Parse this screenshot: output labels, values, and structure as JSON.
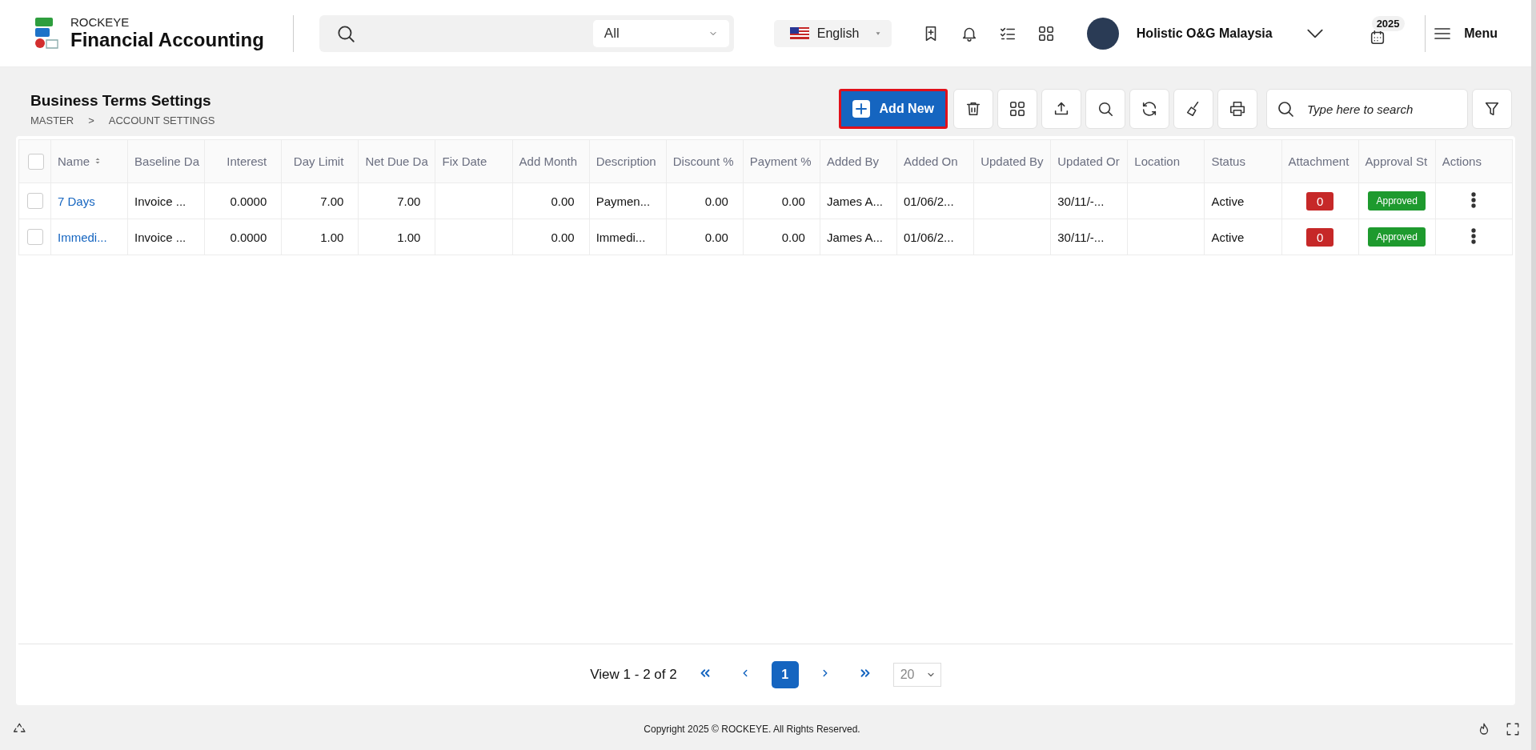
{
  "header": {
    "brand_small": "ROCKEYE",
    "brand_title": "Financial Accounting",
    "search": {
      "scope": "All"
    },
    "language": "English",
    "company": "Holistic O&G Malaysia",
    "year": "2025",
    "menu_label": "Menu"
  },
  "page": {
    "title": "Business Terms Settings",
    "breadcrumb": [
      "MASTER",
      "ACCOUNT SETTINGS"
    ],
    "breadcrumb_separator": ">"
  },
  "toolbar": {
    "add_button": "Add New",
    "search": {
      "placeholder": "Type here to search"
    }
  },
  "table": {
    "all_selected": false,
    "columns": [
      {
        "label": "Name",
        "kind": "link",
        "sortable": true
      },
      {
        "label": "Baseline Da",
        "kind": "text"
      },
      {
        "label": "Interest",
        "kind": "num"
      },
      {
        "label": "Day Limit",
        "kind": "num"
      },
      {
        "label": "Net Due Da",
        "kind": "num"
      },
      {
        "label": "Fix Date",
        "kind": "text"
      },
      {
        "label": "Add Month",
        "kind": "num"
      },
      {
        "label": "Description",
        "kind": "text"
      },
      {
        "label": "Discount %",
        "kind": "num"
      },
      {
        "label": "Payment %",
        "kind": "num"
      },
      {
        "label": "Added By",
        "kind": "text"
      },
      {
        "label": "Added On",
        "kind": "text"
      },
      {
        "label": "Updated By",
        "kind": "text"
      },
      {
        "label": "Updated Or",
        "kind": "text"
      },
      {
        "label": "Location",
        "kind": "text"
      },
      {
        "label": "Status",
        "kind": "text"
      },
      {
        "label": "Attachment",
        "kind": "count"
      },
      {
        "label": "Approval St",
        "kind": "approval"
      },
      {
        "label": "Actions",
        "kind": "menu"
      }
    ],
    "rows": [
      {
        "selected": false,
        "cells": [
          "7 Days",
          "Invoice ...",
          "0.0000",
          "7.00",
          "7.00",
          "",
          "0.00",
          "Paymen...",
          "0.00",
          "0.00",
          "James A...",
          "01/06/2...",
          "",
          "30/11/-...",
          "",
          "Active",
          "0",
          "Approved",
          ""
        ]
      },
      {
        "selected": false,
        "cells": [
          "Immedi...",
          "Invoice ...",
          "0.0000",
          "1.00",
          "1.00",
          "",
          "0.00",
          "Immedi...",
          "0.00",
          "0.00",
          "James A...",
          "01/06/2...",
          "",
          "30/11/-...",
          "",
          "Active",
          "0",
          "Approved",
          ""
        ]
      }
    ]
  },
  "pagination": {
    "summary": "View 1 - 2 of 2",
    "pages": [
      {
        "label": "1",
        "selected": true
      }
    ],
    "page_size": "20"
  },
  "footer": {
    "copyright": "Copyright 2025 © ROCKEYE. All Rights Reserved."
  }
}
